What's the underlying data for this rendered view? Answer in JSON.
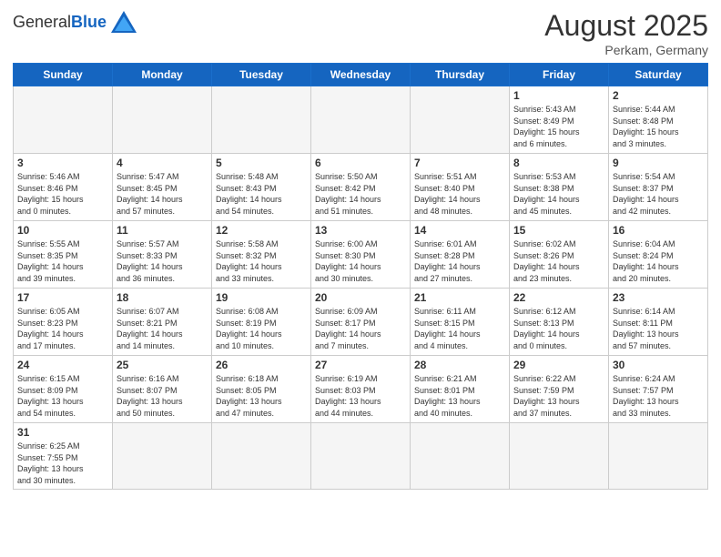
{
  "header": {
    "logo_general": "General",
    "logo_blue": "Blue",
    "month_year": "August 2025",
    "location": "Perkam, Germany"
  },
  "weekdays": [
    "Sunday",
    "Monday",
    "Tuesday",
    "Wednesday",
    "Thursday",
    "Friday",
    "Saturday"
  ],
  "weeks": [
    [
      {
        "day": "",
        "info": "",
        "empty": true
      },
      {
        "day": "",
        "info": "",
        "empty": true
      },
      {
        "day": "",
        "info": "",
        "empty": true
      },
      {
        "day": "",
        "info": "",
        "empty": true
      },
      {
        "day": "",
        "info": "",
        "empty": true
      },
      {
        "day": "1",
        "info": "Sunrise: 5:43 AM\nSunset: 8:49 PM\nDaylight: 15 hours\nand 6 minutes."
      },
      {
        "day": "2",
        "info": "Sunrise: 5:44 AM\nSunset: 8:48 PM\nDaylight: 15 hours\nand 3 minutes."
      }
    ],
    [
      {
        "day": "3",
        "info": "Sunrise: 5:46 AM\nSunset: 8:46 PM\nDaylight: 15 hours\nand 0 minutes."
      },
      {
        "day": "4",
        "info": "Sunrise: 5:47 AM\nSunset: 8:45 PM\nDaylight: 14 hours\nand 57 minutes."
      },
      {
        "day": "5",
        "info": "Sunrise: 5:48 AM\nSunset: 8:43 PM\nDaylight: 14 hours\nand 54 minutes."
      },
      {
        "day": "6",
        "info": "Sunrise: 5:50 AM\nSunset: 8:42 PM\nDaylight: 14 hours\nand 51 minutes."
      },
      {
        "day": "7",
        "info": "Sunrise: 5:51 AM\nSunset: 8:40 PM\nDaylight: 14 hours\nand 48 minutes."
      },
      {
        "day": "8",
        "info": "Sunrise: 5:53 AM\nSunset: 8:38 PM\nDaylight: 14 hours\nand 45 minutes."
      },
      {
        "day": "9",
        "info": "Sunrise: 5:54 AM\nSunset: 8:37 PM\nDaylight: 14 hours\nand 42 minutes."
      }
    ],
    [
      {
        "day": "10",
        "info": "Sunrise: 5:55 AM\nSunset: 8:35 PM\nDaylight: 14 hours\nand 39 minutes."
      },
      {
        "day": "11",
        "info": "Sunrise: 5:57 AM\nSunset: 8:33 PM\nDaylight: 14 hours\nand 36 minutes."
      },
      {
        "day": "12",
        "info": "Sunrise: 5:58 AM\nSunset: 8:32 PM\nDaylight: 14 hours\nand 33 minutes."
      },
      {
        "day": "13",
        "info": "Sunrise: 6:00 AM\nSunset: 8:30 PM\nDaylight: 14 hours\nand 30 minutes."
      },
      {
        "day": "14",
        "info": "Sunrise: 6:01 AM\nSunset: 8:28 PM\nDaylight: 14 hours\nand 27 minutes."
      },
      {
        "day": "15",
        "info": "Sunrise: 6:02 AM\nSunset: 8:26 PM\nDaylight: 14 hours\nand 23 minutes."
      },
      {
        "day": "16",
        "info": "Sunrise: 6:04 AM\nSunset: 8:24 PM\nDaylight: 14 hours\nand 20 minutes."
      }
    ],
    [
      {
        "day": "17",
        "info": "Sunrise: 6:05 AM\nSunset: 8:23 PM\nDaylight: 14 hours\nand 17 minutes."
      },
      {
        "day": "18",
        "info": "Sunrise: 6:07 AM\nSunset: 8:21 PM\nDaylight: 14 hours\nand 14 minutes."
      },
      {
        "day": "19",
        "info": "Sunrise: 6:08 AM\nSunset: 8:19 PM\nDaylight: 14 hours\nand 10 minutes."
      },
      {
        "day": "20",
        "info": "Sunrise: 6:09 AM\nSunset: 8:17 PM\nDaylight: 14 hours\nand 7 minutes."
      },
      {
        "day": "21",
        "info": "Sunrise: 6:11 AM\nSunset: 8:15 PM\nDaylight: 14 hours\nand 4 minutes."
      },
      {
        "day": "22",
        "info": "Sunrise: 6:12 AM\nSunset: 8:13 PM\nDaylight: 14 hours\nand 0 minutes."
      },
      {
        "day": "23",
        "info": "Sunrise: 6:14 AM\nSunset: 8:11 PM\nDaylight: 13 hours\nand 57 minutes."
      }
    ],
    [
      {
        "day": "24",
        "info": "Sunrise: 6:15 AM\nSunset: 8:09 PM\nDaylight: 13 hours\nand 54 minutes."
      },
      {
        "day": "25",
        "info": "Sunrise: 6:16 AM\nSunset: 8:07 PM\nDaylight: 13 hours\nand 50 minutes."
      },
      {
        "day": "26",
        "info": "Sunrise: 6:18 AM\nSunset: 8:05 PM\nDaylight: 13 hours\nand 47 minutes."
      },
      {
        "day": "27",
        "info": "Sunrise: 6:19 AM\nSunset: 8:03 PM\nDaylight: 13 hours\nand 44 minutes."
      },
      {
        "day": "28",
        "info": "Sunrise: 6:21 AM\nSunset: 8:01 PM\nDaylight: 13 hours\nand 40 minutes."
      },
      {
        "day": "29",
        "info": "Sunrise: 6:22 AM\nSunset: 7:59 PM\nDaylight: 13 hours\nand 37 minutes."
      },
      {
        "day": "30",
        "info": "Sunrise: 6:24 AM\nSunset: 7:57 PM\nDaylight: 13 hours\nand 33 minutes."
      }
    ],
    [
      {
        "day": "31",
        "info": "Sunrise: 6:25 AM\nSunset: 7:55 PM\nDaylight: 13 hours\nand 30 minutes.",
        "last": true
      },
      {
        "day": "",
        "info": "",
        "empty": true,
        "last": true
      },
      {
        "day": "",
        "info": "",
        "empty": true,
        "last": true
      },
      {
        "day": "",
        "info": "",
        "empty": true,
        "last": true
      },
      {
        "day": "",
        "info": "",
        "empty": true,
        "last": true
      },
      {
        "day": "",
        "info": "",
        "empty": true,
        "last": true
      },
      {
        "day": "",
        "info": "",
        "empty": true,
        "last": true
      }
    ]
  ]
}
